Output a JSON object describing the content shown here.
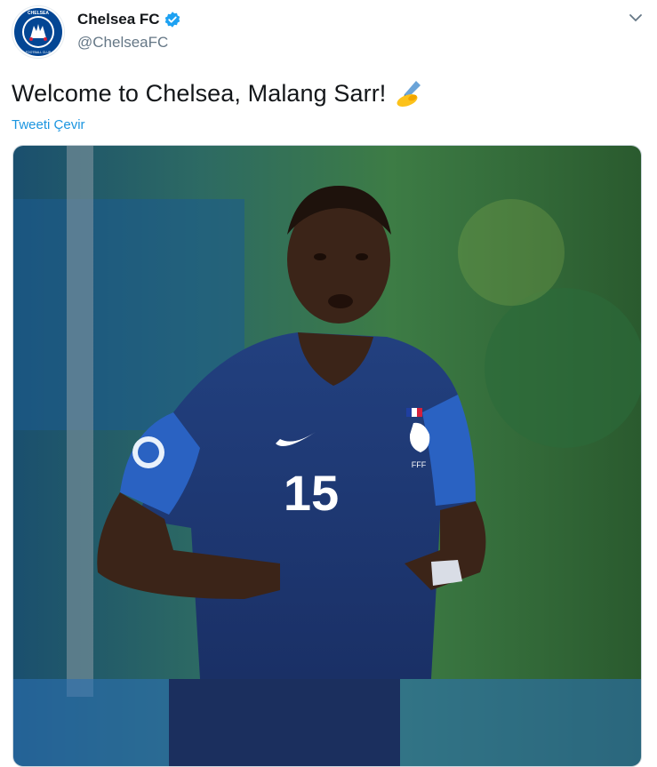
{
  "account": {
    "display_name": "Chelsea FC",
    "handle": "@ChelseaFC",
    "verified_icon": "verified-badge-icon",
    "avatar_text_top": "CHELSEA",
    "avatar_text_bottom": "FOOTBALL CLUB"
  },
  "tweet": {
    "text": "Welcome to Chelsea, Malang Sarr!",
    "emoji": "✍",
    "translate_label": "Tweeti Çevir"
  },
  "menu": {
    "icon": "chevron-down-icon"
  },
  "media": {
    "shirt_number": "15",
    "badge_text": "FFF",
    "brand_icon": "swoosh-icon"
  },
  "colors": {
    "link": "#1b95e0",
    "verified": "#1da1f2",
    "chelsea_blue": "#034694",
    "jersey": "#1f3a7a",
    "sleeve": "#2a62c2"
  }
}
